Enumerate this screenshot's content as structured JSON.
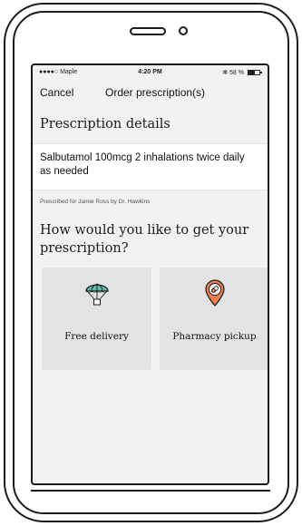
{
  "status_bar": {
    "carrier": "●●●●○ Maple",
    "time": "4:20 PM",
    "battery_text": "58 %",
    "battery_level": 0.58
  },
  "nav": {
    "cancel_label": "Cancel",
    "title": "Order prescription(s)"
  },
  "details": {
    "heading": "Prescription details",
    "medication": "Salbutamol 100mcg 2 inhalations twice daily as needed",
    "prescribed_by": "Prescribed for Jamie Ross by Dr. Hawkins"
  },
  "question": "How would you like to get your prescription?",
  "options": [
    {
      "label": "Free delivery",
      "icon": "parachute-icon"
    },
    {
      "label": "Pharmacy pickup",
      "icon": "pill-location-pin-icon"
    }
  ],
  "colors": {
    "screen_bg": "#f2f2f2",
    "card_bg": "#ffffff",
    "option_bg": "#e3e3e3",
    "delivery_icon": "#5fb8a8",
    "pickup_icon": "#ec7d4f"
  }
}
